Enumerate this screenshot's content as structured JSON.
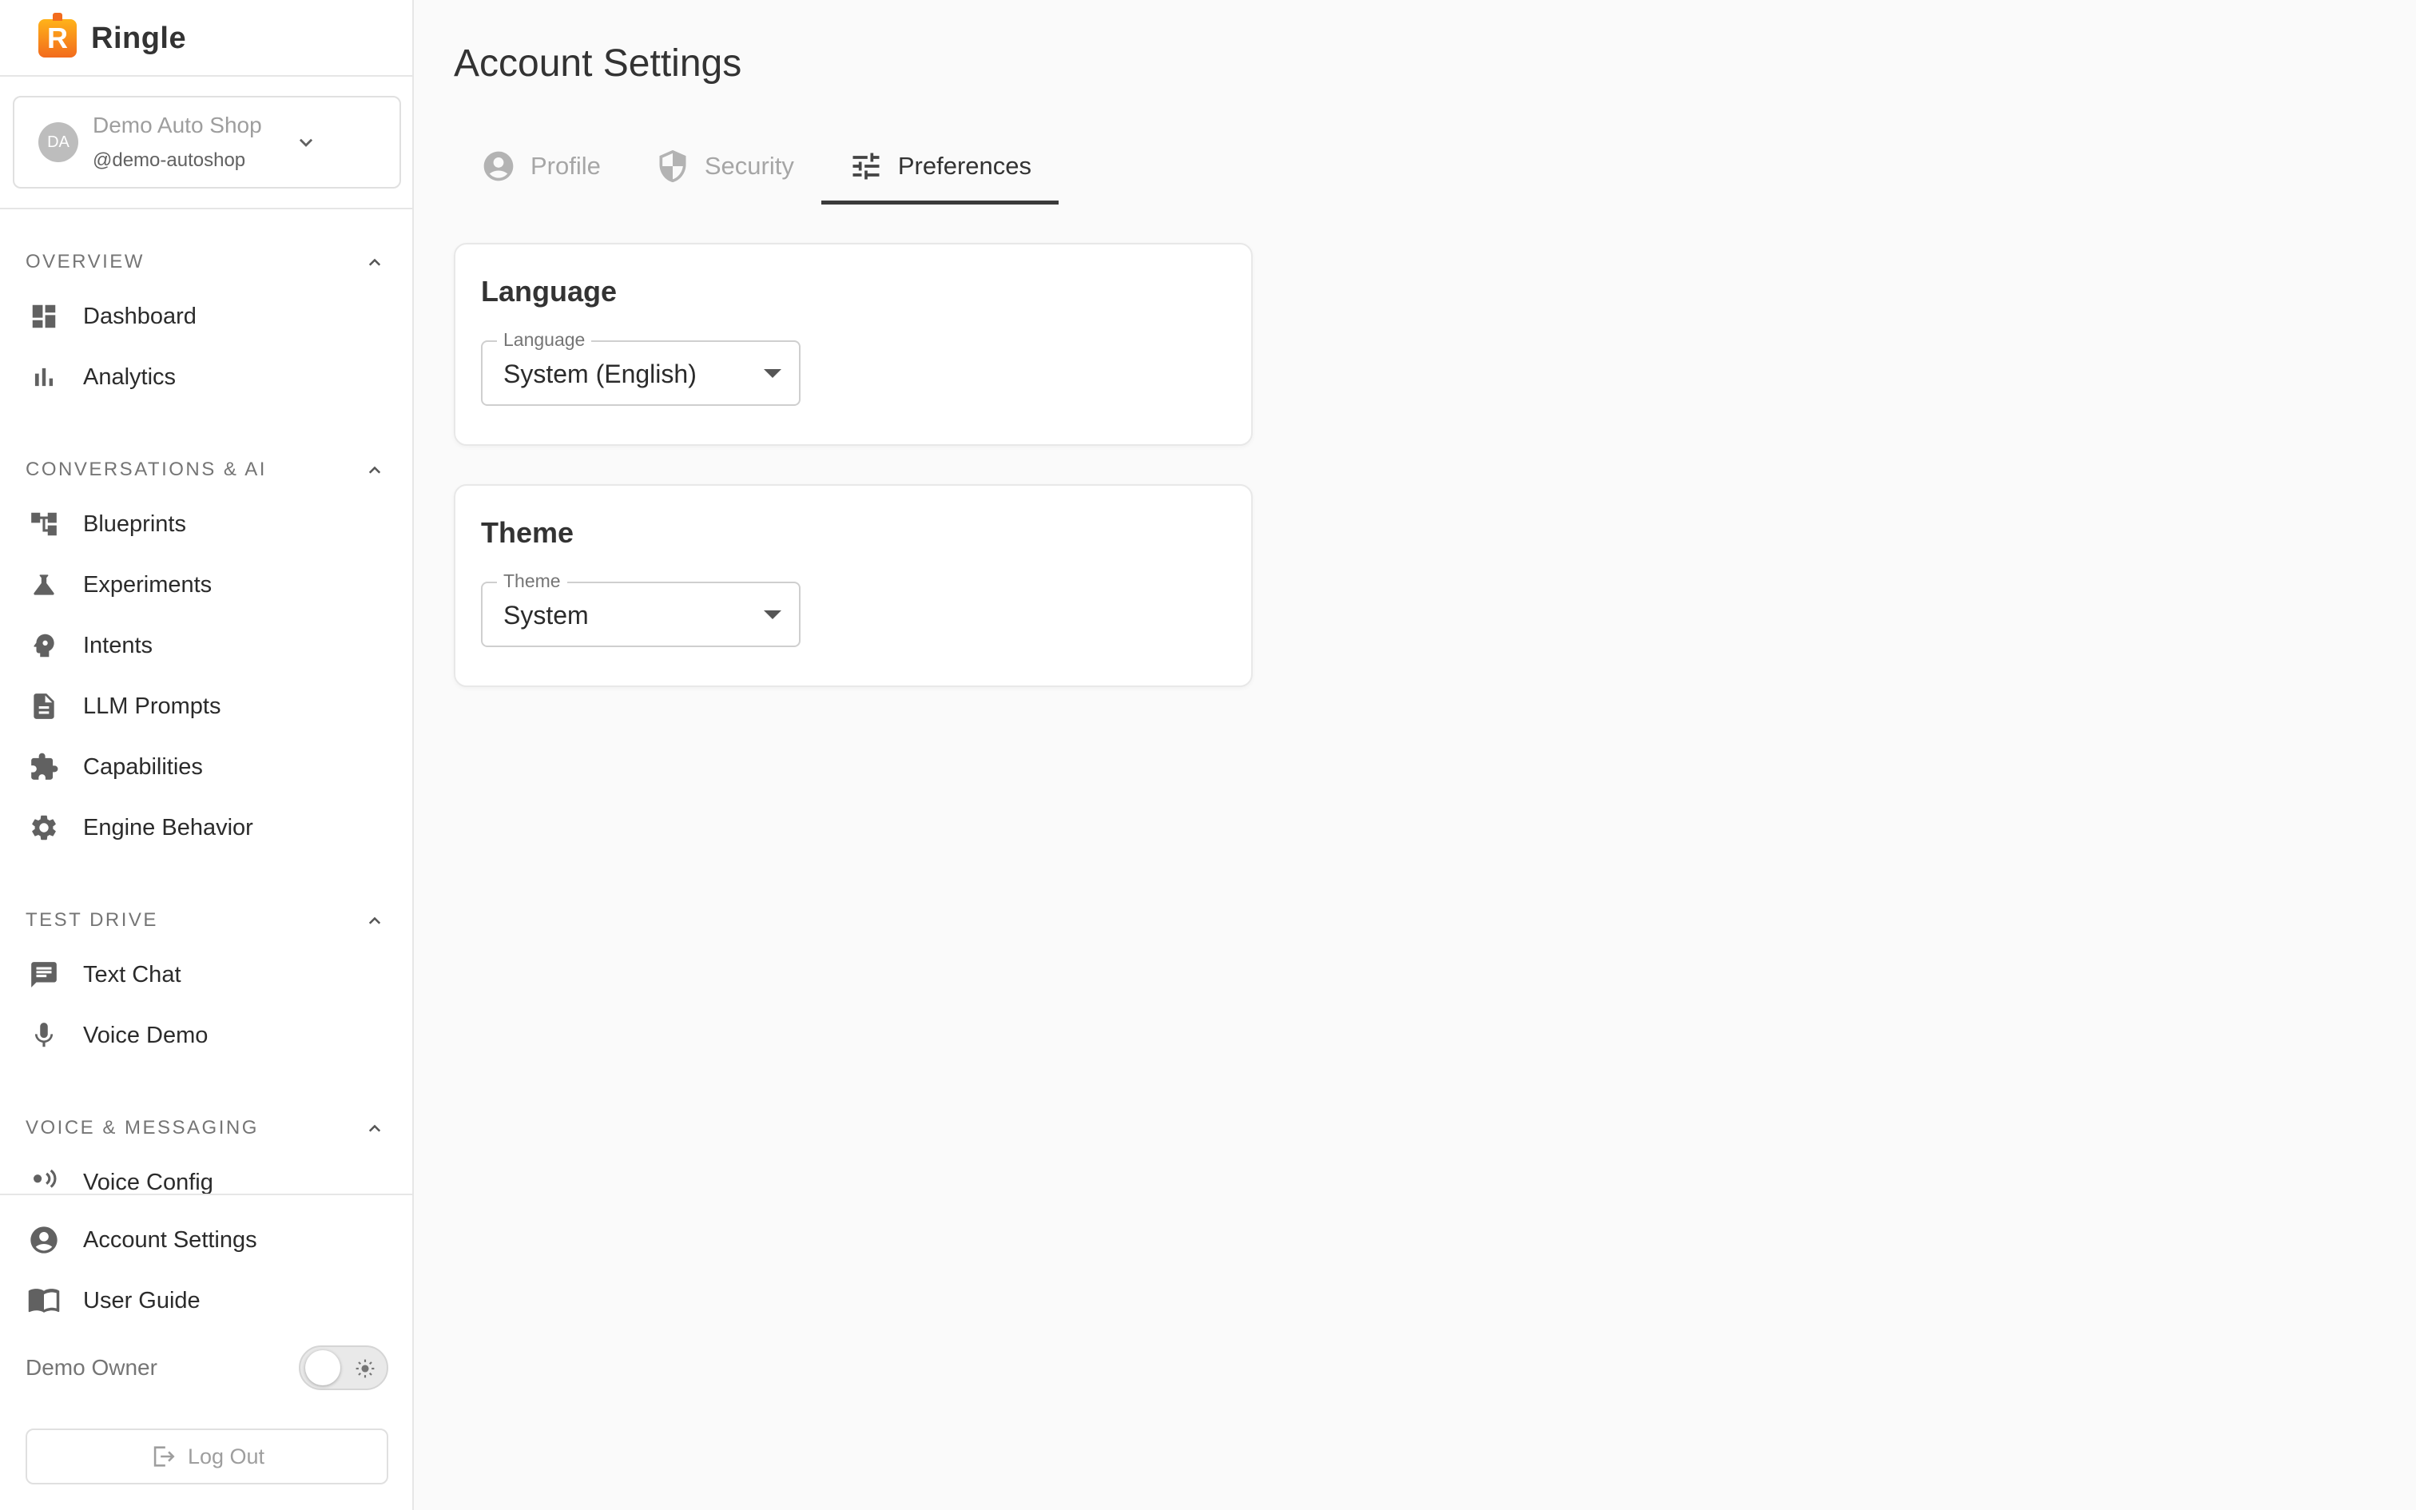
{
  "brand": {
    "logo_letter": "R",
    "name": "Ringle",
    "logo_color": "#f26b1d"
  },
  "org": {
    "avatar_initials": "DA",
    "name": "Demo Auto Shop",
    "handle": "@demo-autoshop"
  },
  "sections": [
    {
      "title": "OVERVIEW",
      "items": [
        {
          "label": "Dashboard",
          "icon": "dashboard-icon"
        },
        {
          "label": "Analytics",
          "icon": "bar-chart-icon"
        }
      ]
    },
    {
      "title": "CONVERSATIONS & AI",
      "items": [
        {
          "label": "Blueprints",
          "icon": "flowchart-icon"
        },
        {
          "label": "Experiments",
          "icon": "flask-icon"
        },
        {
          "label": "Intents",
          "icon": "psychology-icon"
        },
        {
          "label": "LLM Prompts",
          "icon": "document-icon"
        },
        {
          "label": "Capabilities",
          "icon": "puzzle-icon"
        },
        {
          "label": "Engine Behavior",
          "icon": "gear-icon"
        }
      ]
    },
    {
      "title": "TEST DRIVE",
      "items": [
        {
          "label": "Text Chat",
          "icon": "chat-icon"
        },
        {
          "label": "Voice Demo",
          "icon": "microphone-icon"
        }
      ]
    },
    {
      "title": "VOICE & MESSAGING",
      "items": [
        {
          "label": "Voice Config",
          "icon": "voice-icon"
        }
      ]
    }
  ],
  "bottom_nav": [
    {
      "label": "Account Settings",
      "icon": "account-circle-icon"
    },
    {
      "label": "User Guide",
      "icon": "book-icon"
    }
  ],
  "user": {
    "name": "Demo Owner",
    "theme_toggle_on": false
  },
  "logout": {
    "label": "Log Out"
  },
  "page": {
    "title": "Account Settings"
  },
  "tabs": [
    {
      "label": "Profile",
      "icon": "account-circle-icon",
      "active": false
    },
    {
      "label": "Security",
      "icon": "shield-icon",
      "active": false
    },
    {
      "label": "Preferences",
      "icon": "tune-icon",
      "active": true
    }
  ],
  "language_card": {
    "title": "Language",
    "field_label": "Language",
    "value": "System (English)"
  },
  "theme_card": {
    "title": "Theme",
    "field_label": "Theme",
    "value": "System"
  }
}
